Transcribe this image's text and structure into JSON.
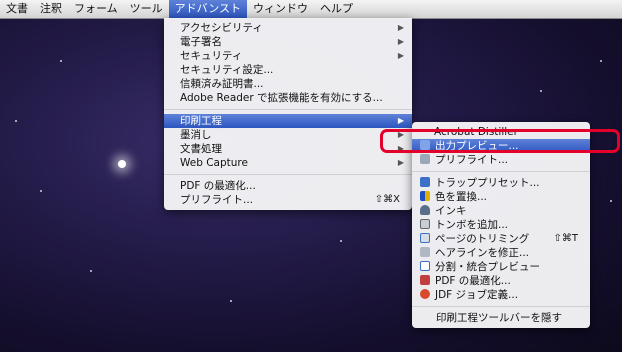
{
  "menubar": {
    "items": [
      "文書",
      "注釈",
      "フォーム",
      "ツール",
      "アドバンスト",
      "ウィンドウ",
      "ヘルプ"
    ],
    "active_index": 4
  },
  "main_menu": {
    "items": [
      {
        "label": "アクセシビリティ",
        "arrow": "▶"
      },
      {
        "label": "電子署名",
        "arrow": "▶"
      },
      {
        "label": "セキュリティ",
        "arrow": "▶"
      },
      {
        "label": "セキュリティ設定..."
      },
      {
        "label": "信頼済み証明書..."
      },
      {
        "label": "Adobe Reader で拡張機能を有効にする..."
      },
      {
        "label": "印刷工程",
        "arrow": "▶"
      },
      {
        "label": "墨消し",
        "arrow": "▶"
      },
      {
        "label": "文書処理",
        "arrow": "▶"
      },
      {
        "label": "Web Capture",
        "arrow": "▶"
      },
      {
        "label": "PDF の最適化..."
      },
      {
        "label": "プリフライト...",
        "shortcut": "⇧⌘X"
      }
    ]
  },
  "submenu": {
    "items": [
      {
        "label": "Acrobat Distiller"
      },
      {
        "label": "出力プレビュー...",
        "icon": "output-preview-icon"
      },
      {
        "label": "プリフライト...",
        "icon": "preflight-icon"
      },
      {
        "label": "トラッププリセット...",
        "icon": "trap-presets-icon"
      },
      {
        "label": "色を置換...",
        "icon": "convert-colors-icon"
      },
      {
        "label": "インキ",
        "icon": "ink-icon"
      },
      {
        "label": "トンボを追加...",
        "icon": "add-printer-marks-icon"
      },
      {
        "label": "ページのトリミング",
        "icon": "crop-pages-icon",
        "shortcut": "⇧⌘T"
      },
      {
        "label": "ヘアラインを修正...",
        "icon": "fix-hairlines-icon"
      },
      {
        "label": "分割・統合プレビュー",
        "icon": "flattener-preview-icon"
      },
      {
        "label": "PDF の最適化...",
        "icon": "optimize-pdf-icon"
      },
      {
        "label": "JDF ジョブ定義...",
        "icon": "jdf-job-icon"
      },
      {
        "label": "印刷工程ツールバーを隠す"
      }
    ]
  },
  "colors": {
    "highlight": "#2c56c0",
    "callout": "#e3002a"
  }
}
